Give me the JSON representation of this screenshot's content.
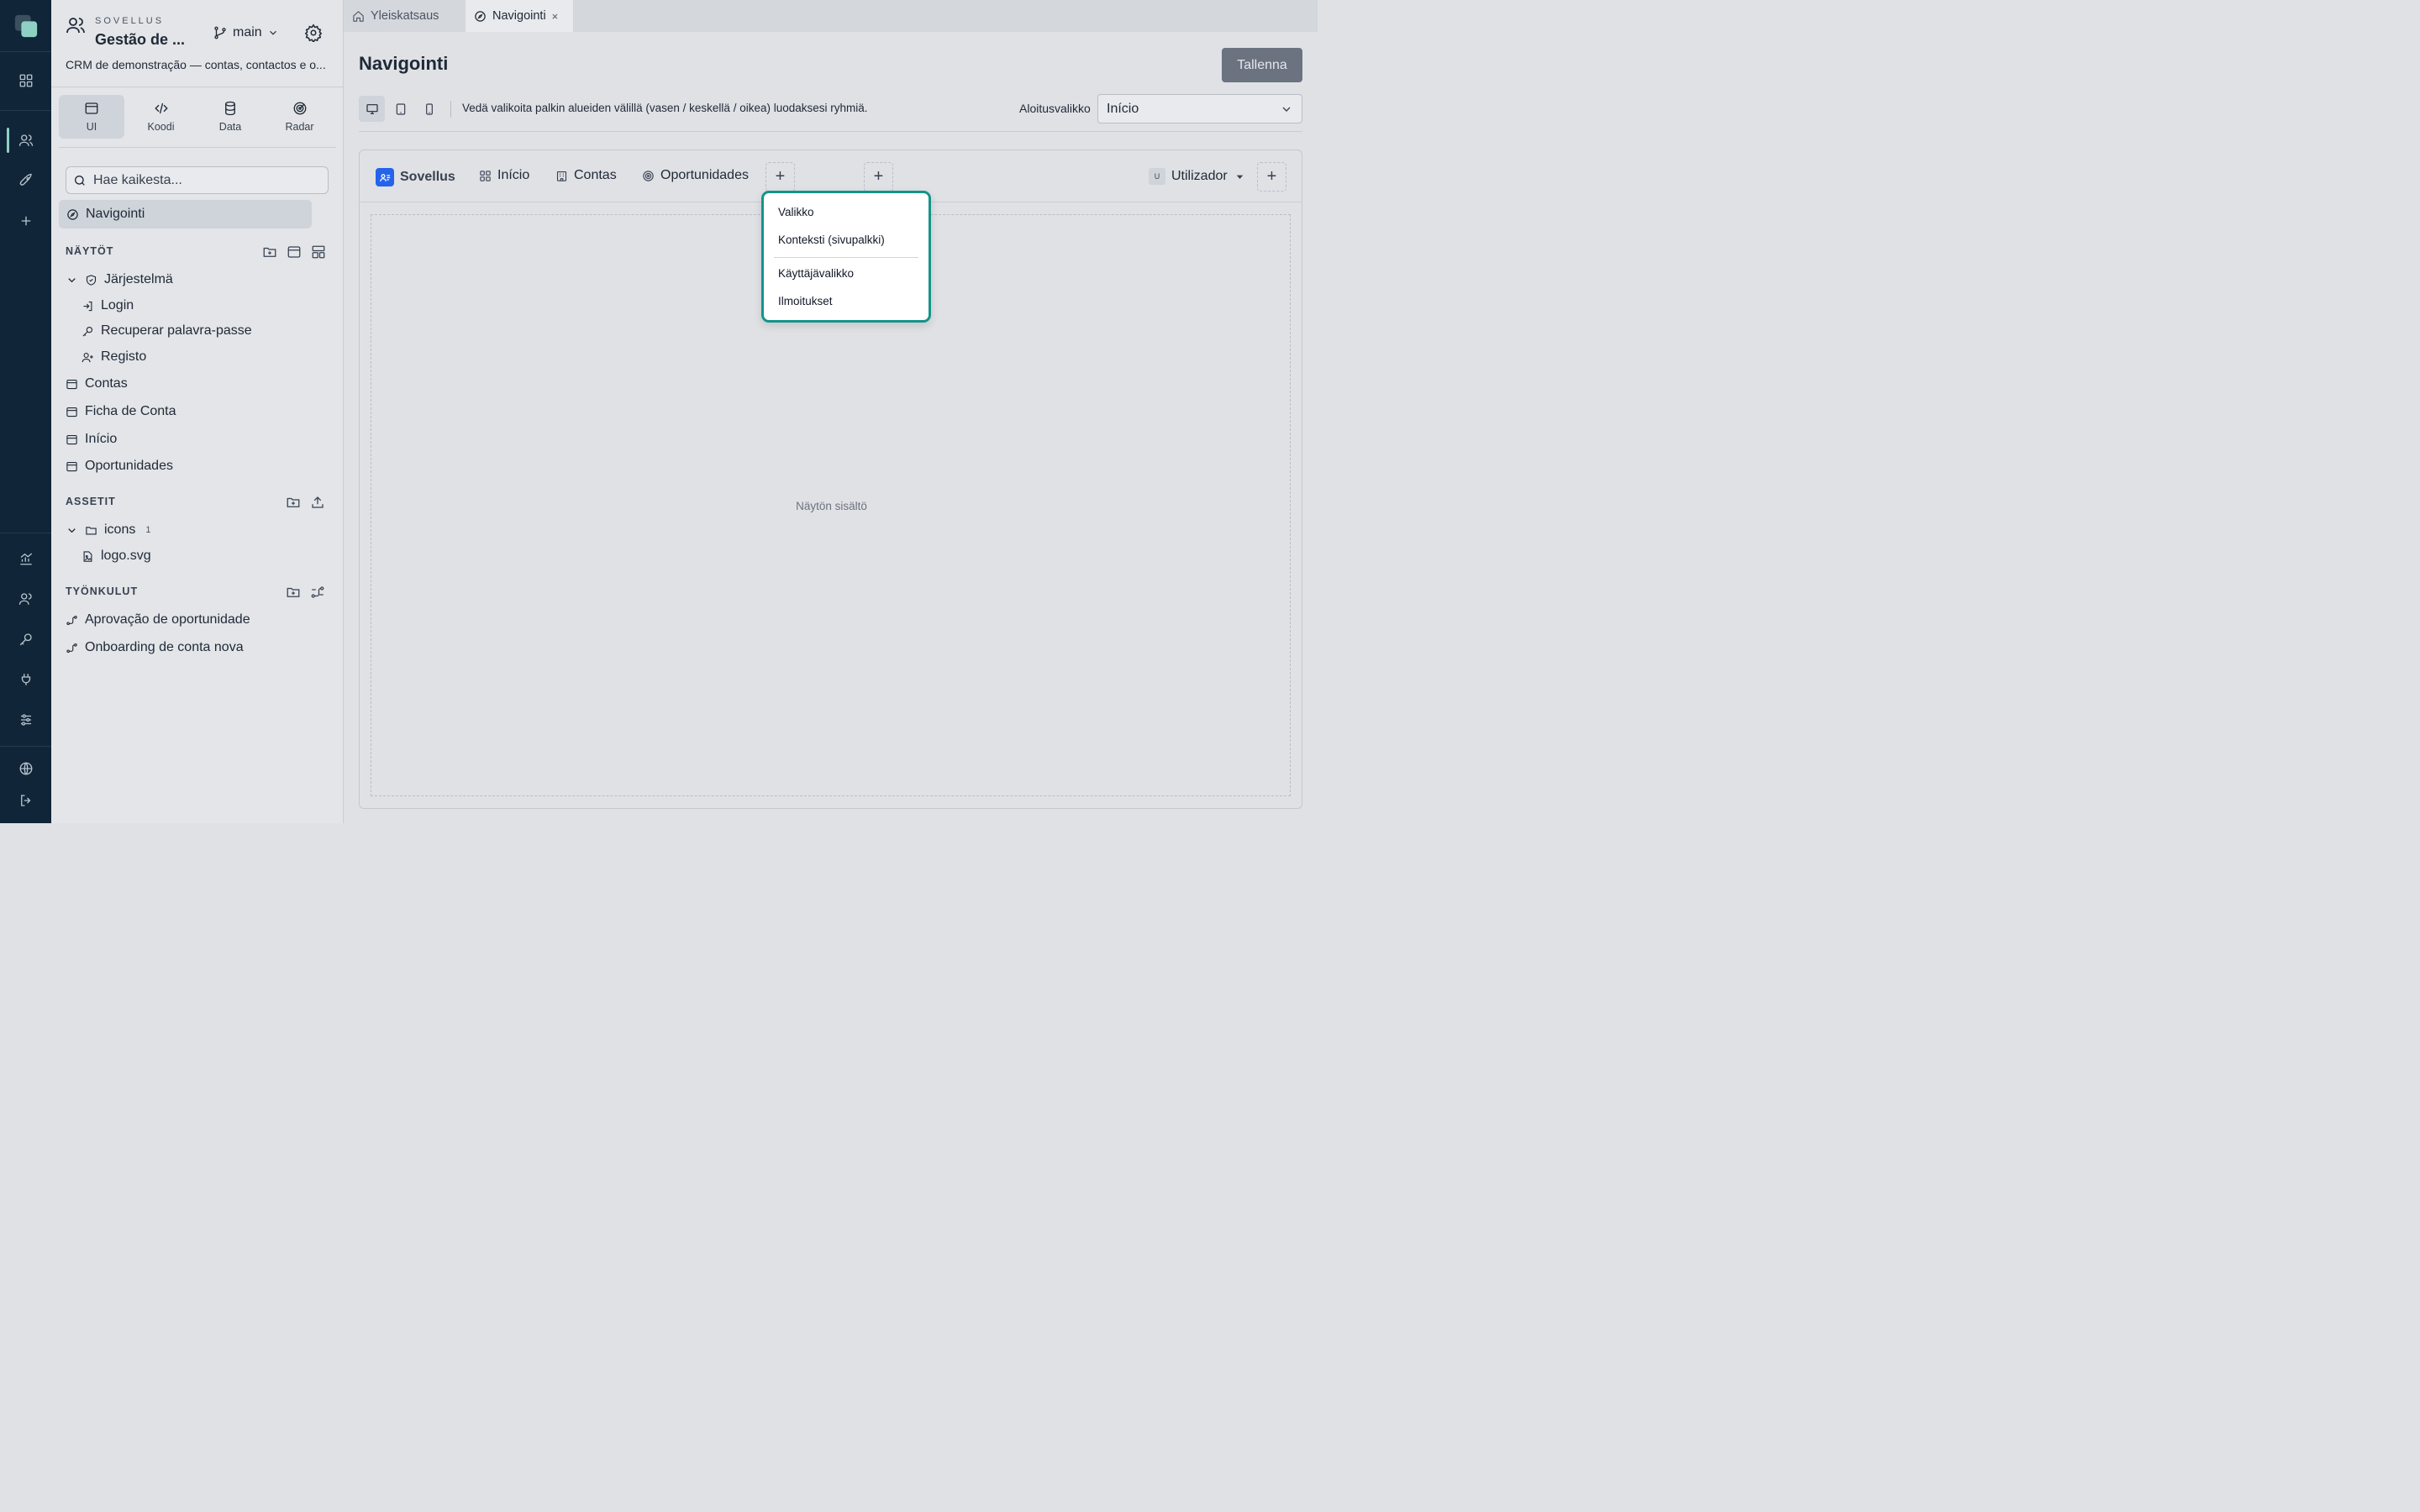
{
  "app": {
    "kicker": "SOVELLUS",
    "project_name": "Gestão de ...",
    "branch": "main",
    "description": "CRM de demonstração — contas, contactos e o..."
  },
  "modes": [
    {
      "label": "UI"
    },
    {
      "label": "Koodi"
    },
    {
      "label": "Data"
    },
    {
      "label": "Radar"
    }
  ],
  "search": {
    "placeholder": "Hae kaikesta..."
  },
  "nav_item": "Navigointi",
  "screens": {
    "heading": "NÄYTÖT",
    "system_folder": "Järjestelmä",
    "system_items": [
      "Login",
      "Recuperar palavra-passe",
      "Registo"
    ],
    "items": [
      "Contas",
      "Ficha de Conta",
      "Início",
      "Oportunidades"
    ]
  },
  "assets": {
    "heading": "ASSETIT",
    "folder": "icons",
    "folder_count": "1",
    "file": "logo.svg"
  },
  "workflows": {
    "heading": "TYÖNKULUT",
    "items": [
      "Aprovação de oportunidade",
      "Onboarding de conta nova"
    ]
  },
  "tabs": [
    {
      "label": "Yleiskatsaus"
    },
    {
      "label": "Navigointi",
      "close": "×"
    }
  ],
  "page": {
    "title": "Navigointi",
    "save_label": "Tallenna",
    "hint": "Vedä valikoita palkin alueiden välillä (vasen / keskellä / oikea) luodaksesi ryhmiä.",
    "start_menu_label": "Aloitusvalikko",
    "start_menu_value": "Início"
  },
  "navbar": {
    "app_label": "Sovellus",
    "items": [
      "Início",
      "Contas",
      "Oportunidades"
    ],
    "user_badge": "U",
    "user_label": "Utilizador",
    "plus": "+"
  },
  "content_placeholder": "Näytön sisältö",
  "dropdown": {
    "items": [
      "Valikko",
      "Konteksti (sivupalkki)",
      "Käyttäjävalikko",
      "Ilmoitukset"
    ]
  },
  "colors": {
    "rail": "#102638",
    "accent": "#14948a",
    "app_logo": "#2563eb"
  }
}
